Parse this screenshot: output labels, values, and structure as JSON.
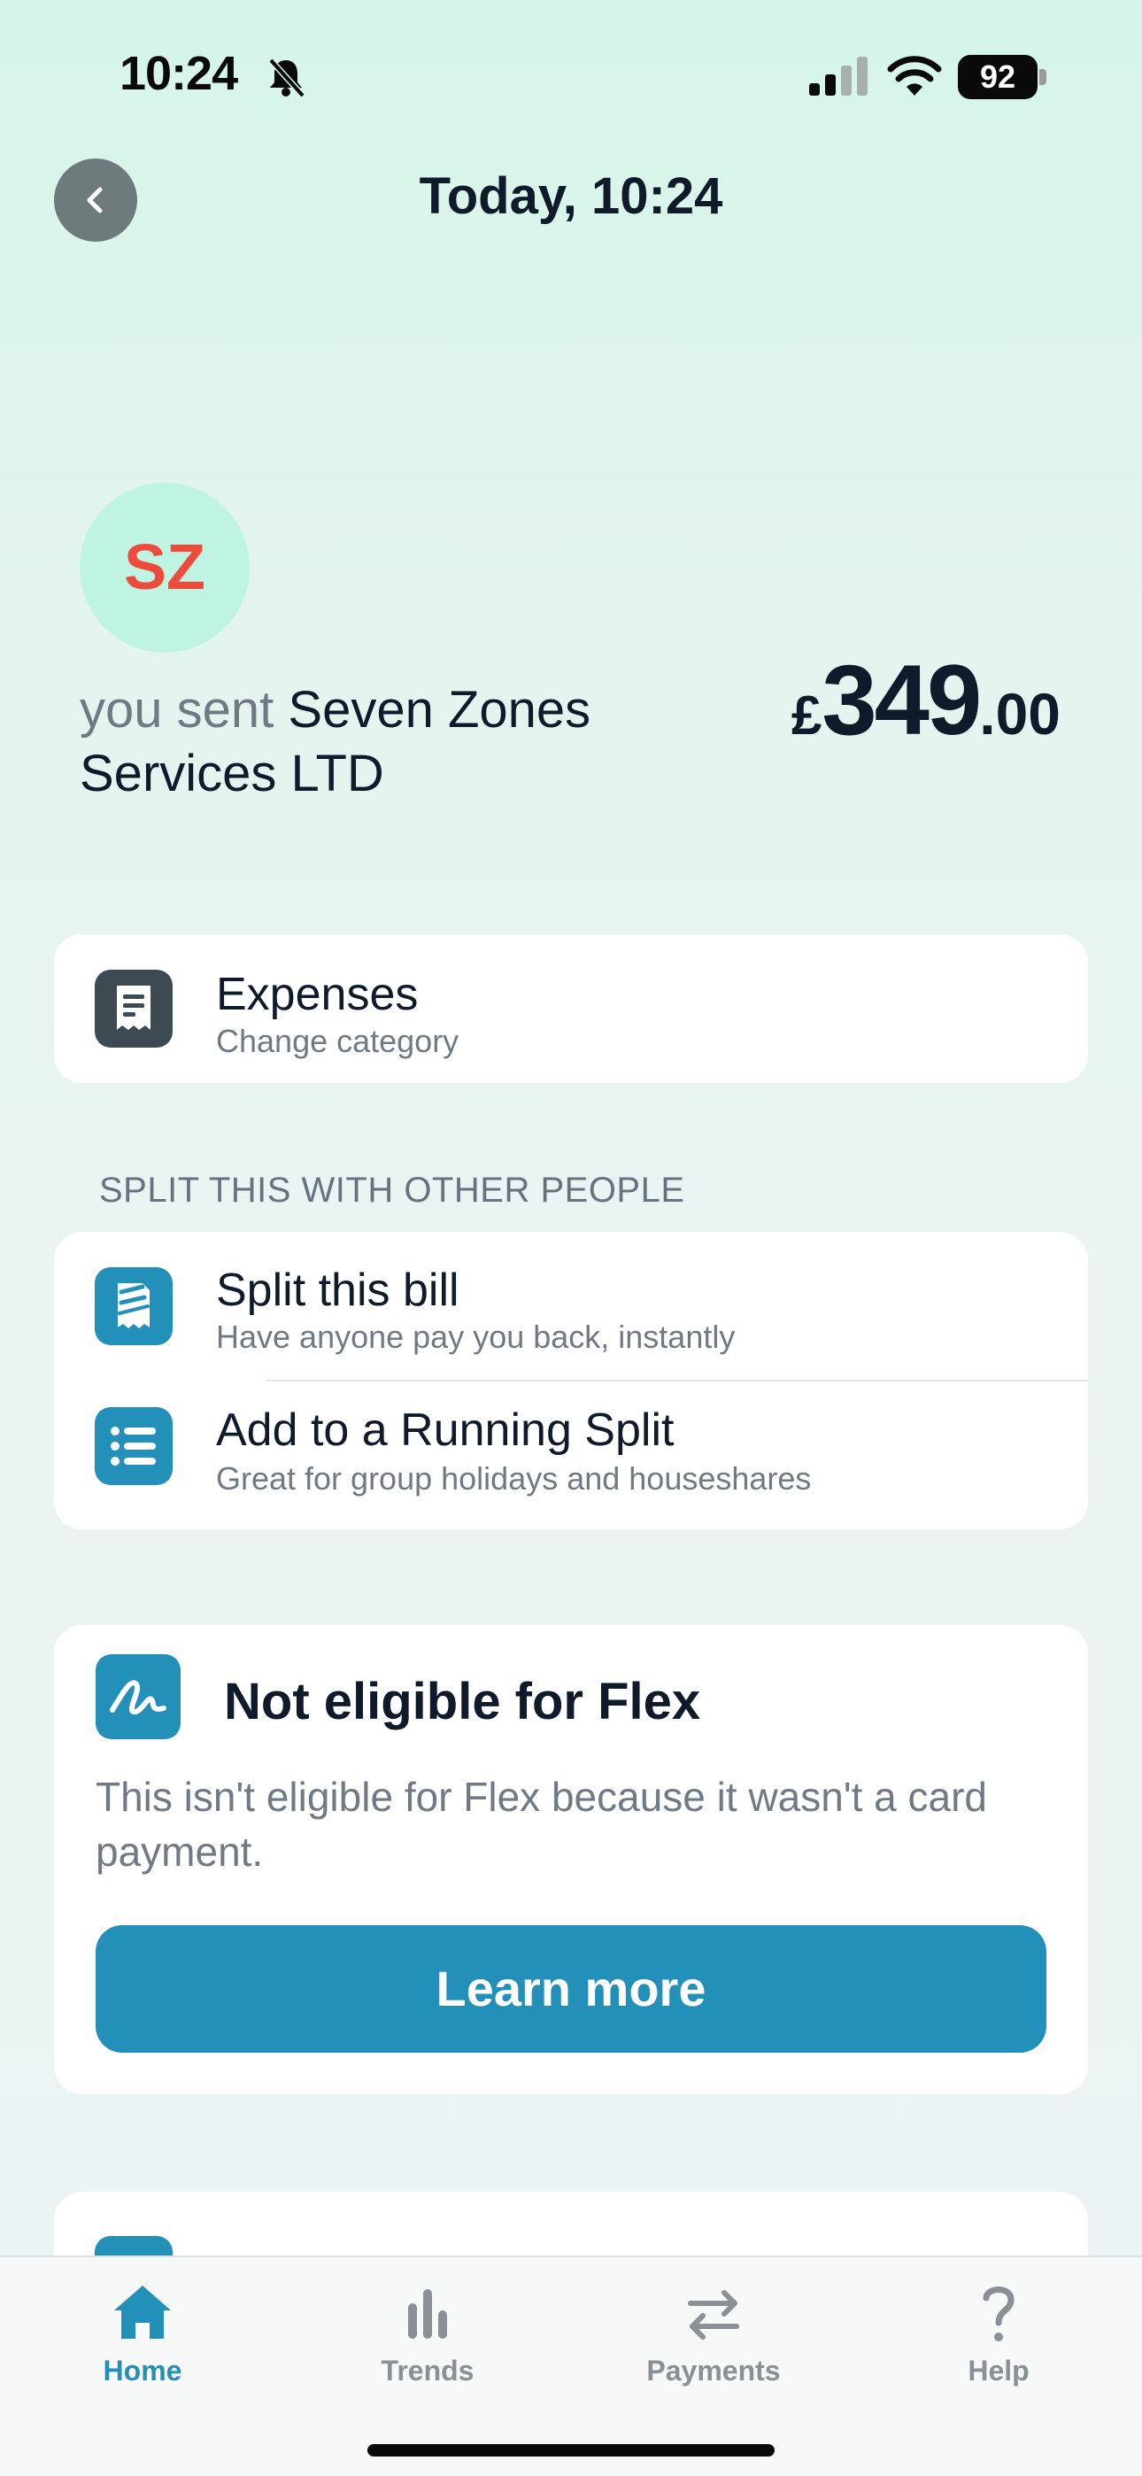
{
  "status_bar": {
    "time": "10:24",
    "battery": "92"
  },
  "header": {
    "title": "Today, 10:24"
  },
  "merchant": {
    "initials": "SZ",
    "sent_prefix": "you sent",
    "name": "Seven Zones Services LTD",
    "amount_currency": "£",
    "amount_main": "349",
    "amount_pence": ".00"
  },
  "category": {
    "title": "Expenses",
    "subtitle": "Change category",
    "icon": "receipt-icon"
  },
  "split": {
    "section_label": "SPLIT THIS WITH OTHER PEOPLE",
    "items": [
      {
        "title": "Split this bill",
        "subtitle": "Have anyone pay you back, instantly",
        "icon": "split-bill-icon"
      },
      {
        "title": "Add to a Running Split",
        "subtitle": "Great for group holidays and houseshares",
        "icon": "list-icon"
      }
    ]
  },
  "flex": {
    "title": "Not eligible for Flex",
    "body": "This isn't eligible for Flex because it wasn't a card payment.",
    "button": "Learn more",
    "icon": "flex-squiggle-icon"
  },
  "tabs": [
    {
      "label": "Home",
      "icon": "home-icon",
      "active": true
    },
    {
      "label": "Trends",
      "icon": "bar-chart-icon",
      "active": false
    },
    {
      "label": "Payments",
      "icon": "arrows-icon",
      "active": false
    },
    {
      "label": "Help",
      "icon": "question-icon",
      "active": false
    }
  ],
  "colors": {
    "accent": "#2390B9",
    "avatar_bg": "#BFF4E2",
    "avatar_text": "#EE4B3D",
    "category_icon_bg": "#3E4A52",
    "background_top": "#D5F5E9"
  }
}
